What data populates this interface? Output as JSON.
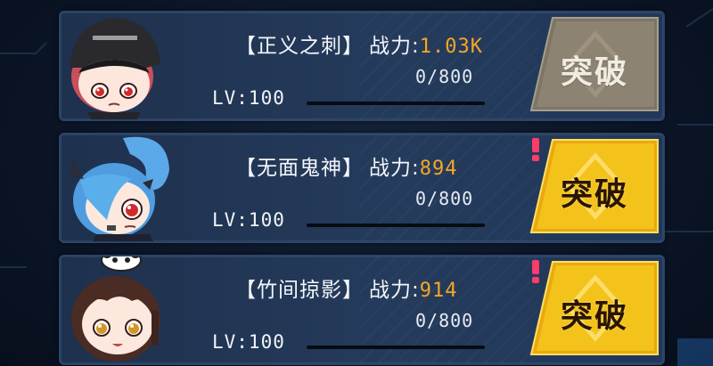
{
  "characters": [
    {
      "name": "【正义之刺】",
      "power_label": "战力:",
      "power_value": "1.03K",
      "exp": "0/800",
      "exp_fraction": 0,
      "level": "LV:100",
      "break_label": "突破",
      "break_state": "disabled",
      "has_alert": false,
      "avatar": "girl-black-cap-icon"
    },
    {
      "name": "【无面鬼神】",
      "power_label": "战力:",
      "power_value": "894",
      "exp": "0/800",
      "exp_fraction": 0,
      "level": "LV:100",
      "break_label": "突破",
      "break_state": "active",
      "has_alert": true,
      "avatar": "girl-blue-hair-icon"
    },
    {
      "name": "【竹间掠影】",
      "power_label": "战力:",
      "power_value": "914",
      "exp": "0/800",
      "exp_fraction": 0,
      "level": "LV:100",
      "break_label": "突破",
      "break_state": "active",
      "has_alert": true,
      "avatar": "girl-panda-hat-icon"
    }
  ],
  "colors": {
    "power": "#f5a623",
    "button_active": "#f3c21b",
    "button_disabled": "#8d8372",
    "alert": "#ff3b6a"
  }
}
